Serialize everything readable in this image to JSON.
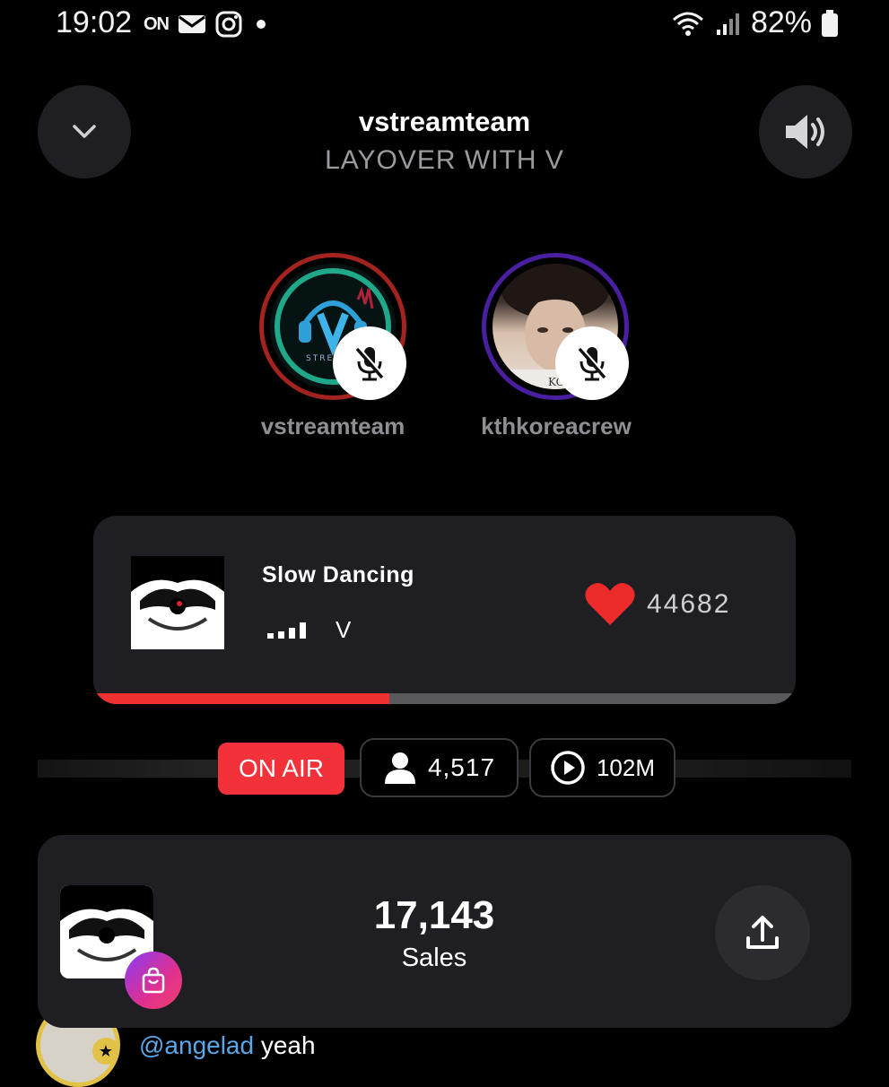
{
  "status_bar": {
    "time": "19:02",
    "on_label": "ON",
    "battery": "82%"
  },
  "header": {
    "title": "vstreamteam",
    "subtitle": "LAYOVER WITH V"
  },
  "hosts": [
    {
      "name": "vstreamteam",
      "ring_color": "#a3231f",
      "muted": true
    },
    {
      "name": "kthkoreacrew",
      "ring_color": "#4a1ea0",
      "muted": true
    }
  ],
  "now_playing": {
    "title": "Slow Dancing",
    "artist": "V",
    "likes": "44682",
    "progress": 0.42
  },
  "stats": {
    "on_air": "ON AIR",
    "listeners": "4,517",
    "plays": "102M"
  },
  "sales": {
    "count": "17,143",
    "label": "Sales"
  },
  "comment": {
    "user": "@angelad",
    "text": "yeah"
  },
  "colors": {
    "accent_red": "#ee3030",
    "on_air_red": "#f2313b",
    "card_bg": "#1f1f23",
    "mention_blue": "#5ba7e8"
  }
}
